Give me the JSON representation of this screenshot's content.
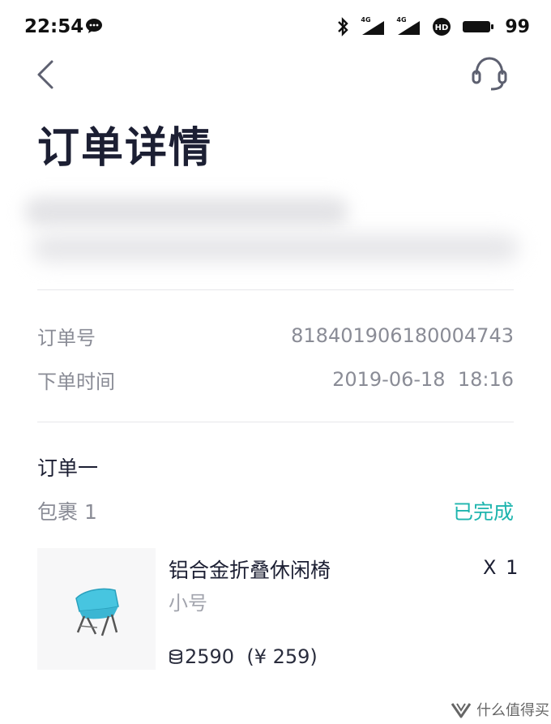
{
  "status_bar": {
    "time": "22:54",
    "network_1": "4G",
    "network_2": "4G",
    "hd_badge": "HD",
    "battery": "99"
  },
  "header": {
    "back_icon": "chevron-left-icon",
    "support_icon": "headset-icon",
    "title": "订单详情"
  },
  "order_info": {
    "order_no_label": "订单号",
    "order_no_value": "818401906180004743",
    "time_label": "下单时间",
    "time_value": "2019-06-18  18:16"
  },
  "order": {
    "section_title": "订单一",
    "package_label": "包裹 1",
    "status": "已完成",
    "status_color": "#1eb5ae",
    "item": {
      "name": "铝合金折叠休闲椅",
      "variant": "小号",
      "quantity": "X 1",
      "price": "2590  (¥ 259)"
    }
  },
  "watermark": {
    "text": "什么值得买"
  }
}
